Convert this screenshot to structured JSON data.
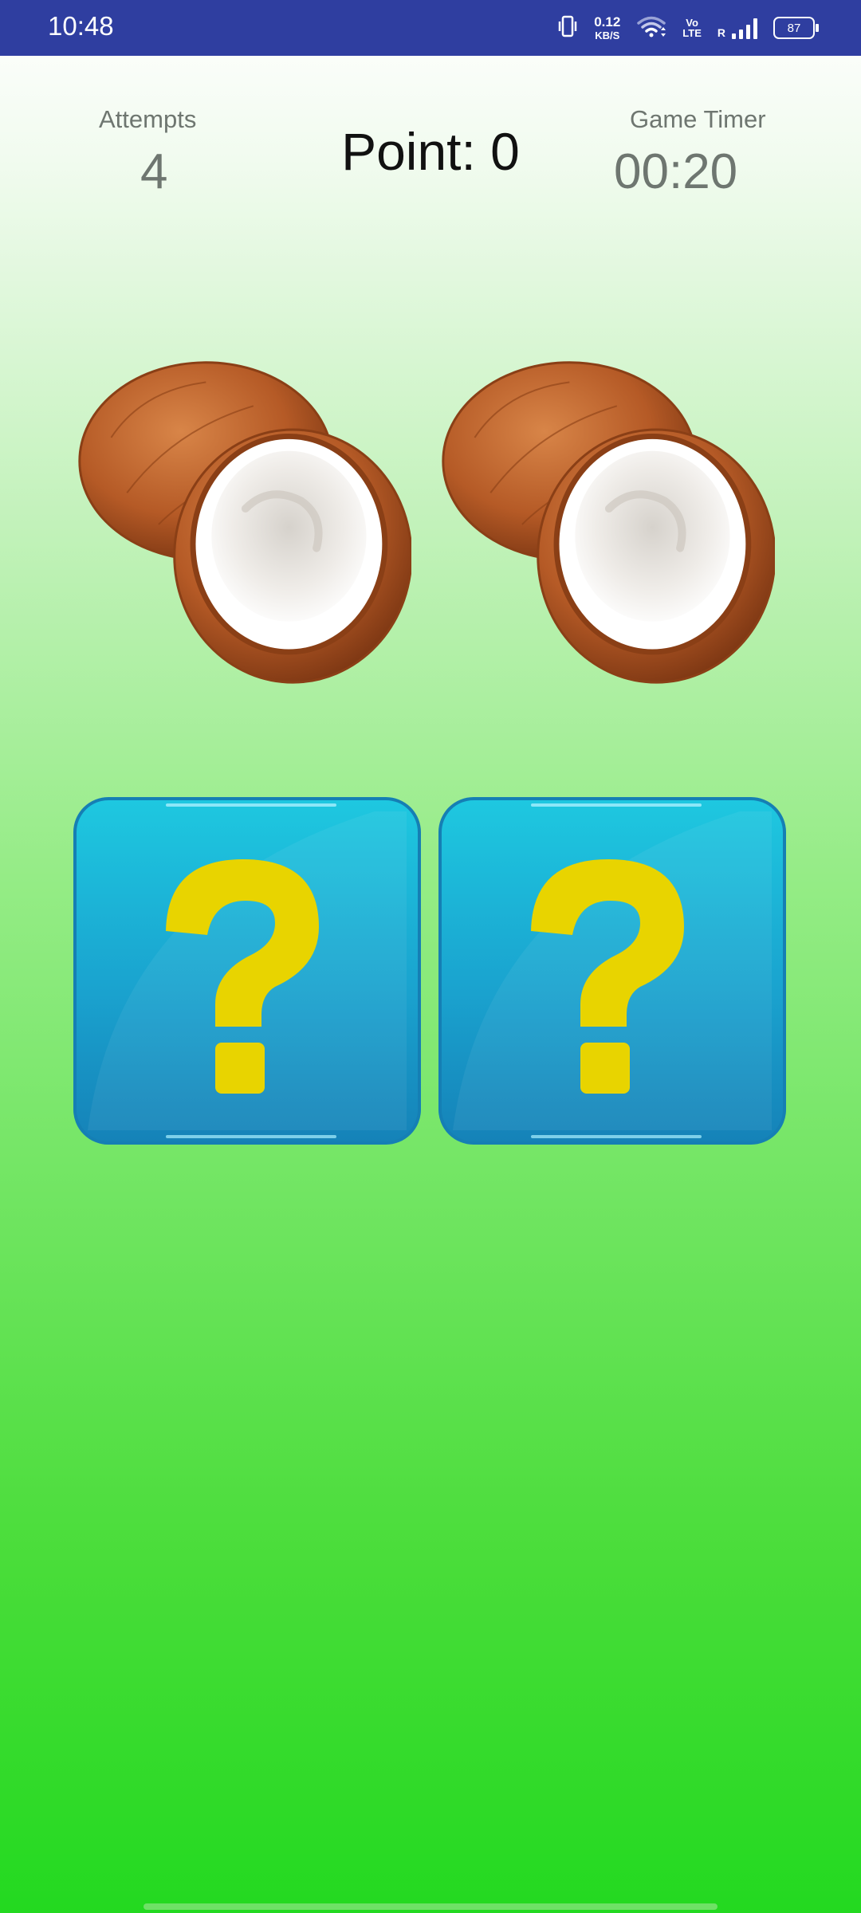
{
  "status_bar": {
    "time": "10:48",
    "net_speed_value": "0.12",
    "net_speed_unit": "KB/S",
    "volte_top": "Vo",
    "volte_bottom": "LTE",
    "roaming": "R",
    "battery": "87",
    "icons": [
      "vibrate-icon",
      "wifi-icon",
      "signal-icon",
      "battery-icon"
    ]
  },
  "hud": {
    "attempts_label": "Attempts",
    "attempts_value": "4",
    "point_label": "Point: 0",
    "timer_label": "Game Timer",
    "timer_value": "00:20"
  },
  "cards": [
    {
      "state": "revealed",
      "content": "coconut-image"
    },
    {
      "state": "revealed",
      "content": "coconut-image"
    },
    {
      "state": "hidden",
      "content": "question-mark-icon"
    },
    {
      "state": "hidden",
      "content": "question-mark-icon"
    }
  ],
  "colors": {
    "status_bar": "#2f3ea0",
    "hud_text": "#6e7670",
    "card_back": "#1fb3d6",
    "question_mark": "#e8d400",
    "coconut_husk": "#b55a26",
    "background_bottom": "#23d920"
  }
}
